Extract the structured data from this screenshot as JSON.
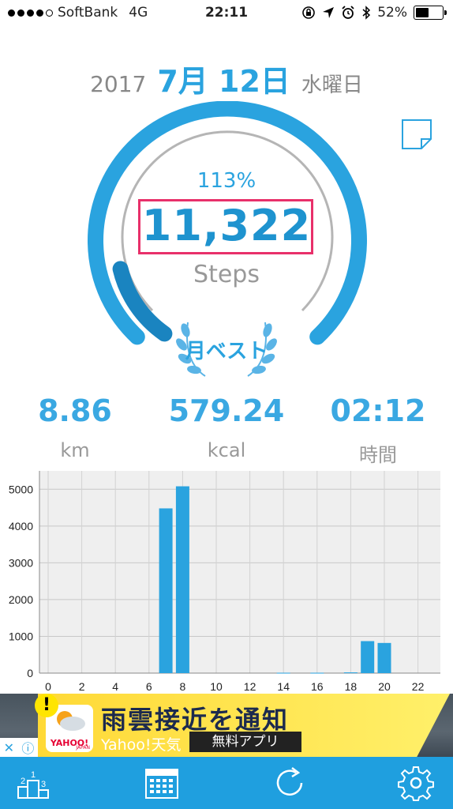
{
  "status": {
    "carrier": "SoftBank",
    "network": "4G",
    "time": "22:11",
    "battery": "52%",
    "signal_bars": 4
  },
  "date": {
    "year": "2017",
    "month_day": "7月 12日",
    "weekday": "水曜日"
  },
  "ring": {
    "percent": "113%",
    "steps": "11,322",
    "steps_label": "Steps",
    "badge": "月ベスト",
    "progress_fraction": 0.13
  },
  "metrics": [
    {
      "value": "8.86",
      "unit": "km"
    },
    {
      "value": "579.24",
      "unit": "kcal"
    },
    {
      "value": "02:12",
      "unit": "時間"
    }
  ],
  "chart_data": {
    "type": "bar",
    "x": [
      0,
      1,
      2,
      3,
      4,
      5,
      6,
      7,
      8,
      9,
      10,
      11,
      12,
      13,
      14,
      15,
      16,
      17,
      18,
      19,
      20,
      21,
      22,
      23
    ],
    "values": [
      0,
      0,
      0,
      0,
      0,
      0,
      0,
      4480,
      5080,
      0,
      0,
      0,
      0,
      0,
      10,
      0,
      10,
      0,
      20,
      870,
      820,
      0,
      0,
      0
    ],
    "xticks": [
      "0",
      "2",
      "4",
      "6",
      "8",
      "10",
      "12",
      "14",
      "16",
      "18",
      "20",
      "22"
    ],
    "yticks": [
      "0",
      "1000",
      "2000",
      "3000",
      "4000",
      "5000"
    ],
    "ylim": [
      0,
      5500
    ],
    "color": "#2aa3df",
    "grid": true
  },
  "ad": {
    "title": "雨雲接近を通知",
    "brand": "Yahoo!天気",
    "cta": "無料アプリ",
    "alert_glyph": "!",
    "logo_text": "YAHOO!",
    "logo_subtext": "JAPAN",
    "close_glyph": "✕",
    "info_glyph": "ⓘ"
  },
  "colors": {
    "accent": "#2aa3df",
    "highlight_box": "#e8306a",
    "tabbar": "#1f9fdf"
  }
}
